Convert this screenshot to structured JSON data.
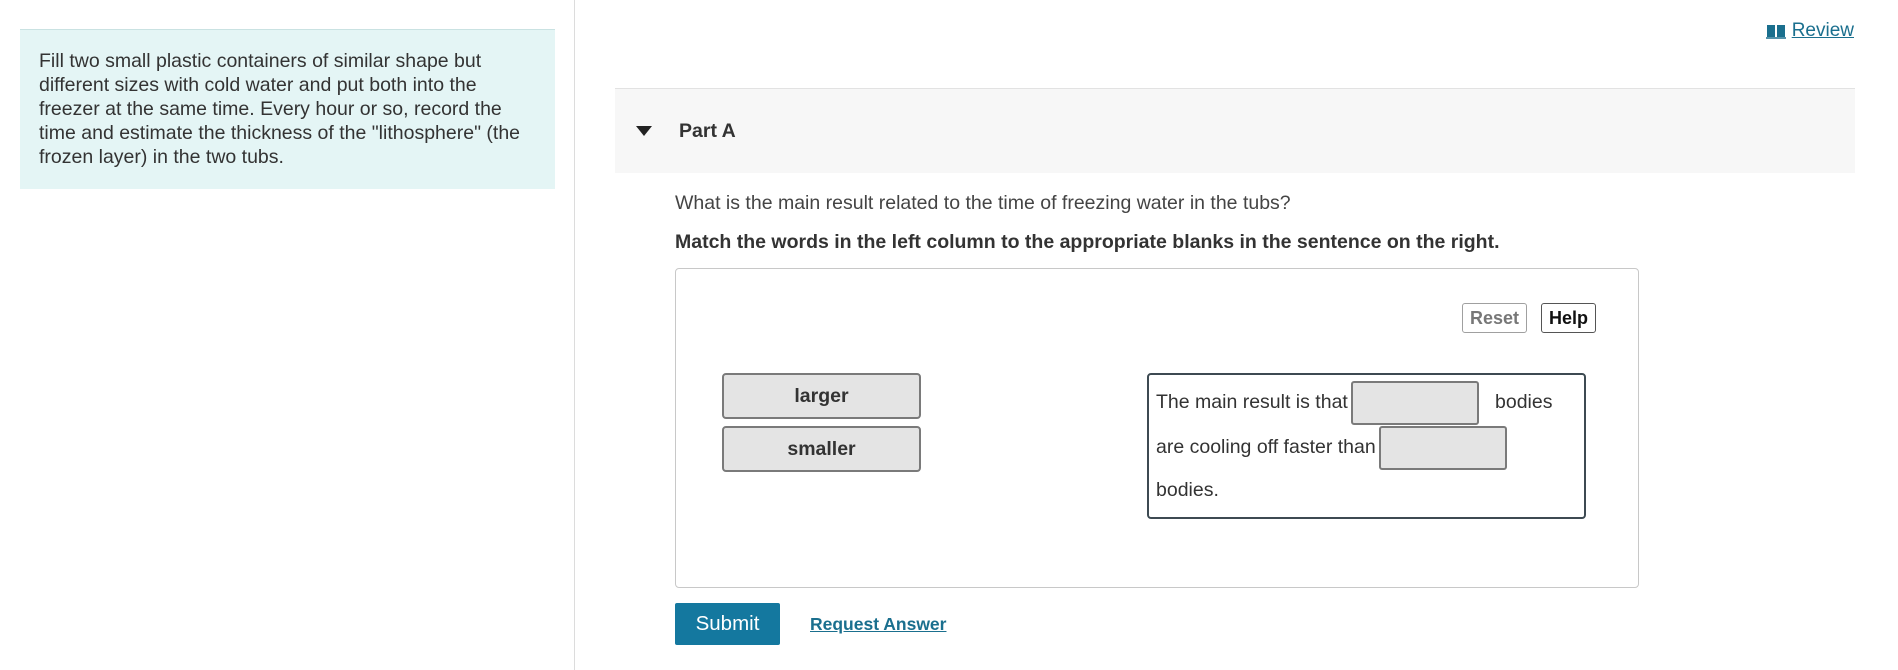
{
  "intro": {
    "text": "Fill two small plastic containers of similar shape but different sizes with cold water and put both into the freezer at the same time. Every hour or so, record the time and estimate the thickness of the \"lithosphere\" (the frozen layer) in the two tubs."
  },
  "header": {
    "review_label": "Review",
    "review_icon": "book-icon"
  },
  "part": {
    "title": "Part A",
    "expanded": true,
    "question": "What is the main result related to the time of freezing water in the tubs?",
    "instruction": "Match the words in the left column to the appropriate blanks in the sentence on the right."
  },
  "dnd": {
    "reset_label": "Reset",
    "help_label": "Help",
    "words": [
      "larger",
      "smaller"
    ],
    "sentence": {
      "part1": "The main result is that",
      "part2": "bodies",
      "part3": "are cooling off faster than",
      "part4": "bodies.",
      "blanks": [
        "",
        ""
      ]
    }
  },
  "actions": {
    "submit_label": "Submit",
    "request_label": "Request Answer"
  },
  "colors": {
    "accent": "#14789f",
    "link": "#1a6f8e",
    "intro_bg": "#e4f5f5"
  }
}
